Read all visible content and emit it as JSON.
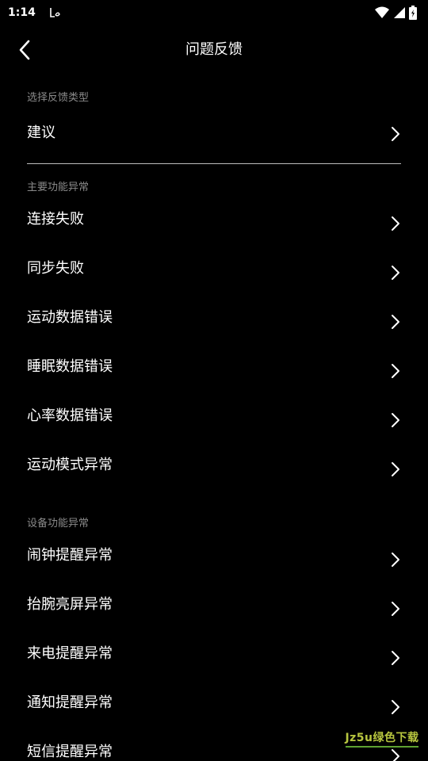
{
  "status_bar": {
    "time": "1:14",
    "icons": [
      "notification-icon",
      "wifi-icon",
      "signal-icon",
      "battery-charging-icon"
    ]
  },
  "header": {
    "title": "问题反馈",
    "back_icon": "chevron-left-icon"
  },
  "sections": [
    {
      "label": "选择反馈类型",
      "items": [
        {
          "label": "建议"
        }
      ]
    },
    {
      "label": "主要功能异常",
      "items": [
        {
          "label": "连接失败"
        },
        {
          "label": "同步失败"
        },
        {
          "label": "运动数据错误"
        },
        {
          "label": "睡眠数据错误"
        },
        {
          "label": "心率数据错误"
        },
        {
          "label": "运动模式异常"
        }
      ]
    },
    {
      "label": "设备功能异常",
      "items": [
        {
          "label": "闹钟提醒异常"
        },
        {
          "label": "抬腕亮屏异常"
        },
        {
          "label": "来电提醒异常"
        },
        {
          "label": "通知提醒异常"
        },
        {
          "label": "短信提醒异常"
        }
      ]
    }
  ],
  "watermark": {
    "text": "Jz5u绿色下载"
  },
  "colors": {
    "background": "#000000",
    "text": "#ffffff",
    "section_label": "#8a8a8a",
    "divider": "#bdbdbd"
  }
}
